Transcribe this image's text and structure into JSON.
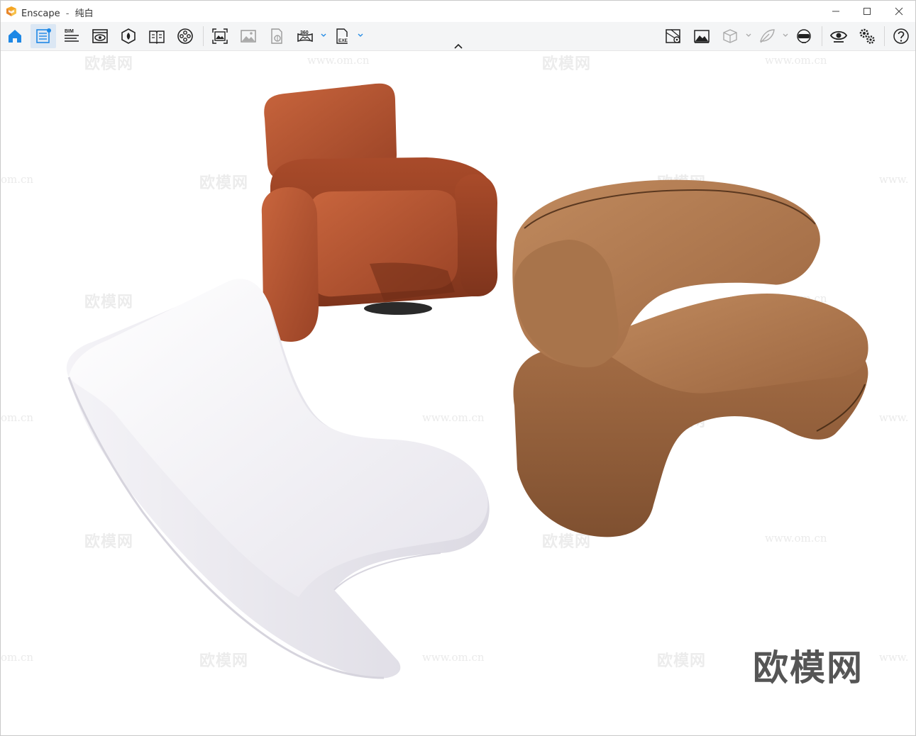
{
  "window": {
    "app_name": "Enscape",
    "separator": "-",
    "document_name": "纯白"
  },
  "toolbar": {
    "left": [
      {
        "name": "home-button",
        "icon": "home-icon",
        "active": false
      },
      {
        "name": "views-button",
        "icon": "view-list-icon",
        "active": true
      },
      {
        "name": "bim-button",
        "icon": "bim-icon",
        "label": "BIM",
        "active": false
      },
      {
        "name": "visual-settings-button",
        "icon": "eye-monitor-icon",
        "active": false
      },
      {
        "name": "asset-library-button",
        "icon": "asset-library-icon",
        "active": false
      },
      {
        "name": "material-editor-button",
        "icon": "book-icon",
        "active": false
      },
      {
        "name": "video-editor-button",
        "icon": "film-reel-icon",
        "active": false
      }
    ],
    "capture": [
      {
        "name": "screenshot-button",
        "icon": "screenshot-icon"
      },
      {
        "name": "batch-render-button",
        "icon": "image-gallery-icon"
      },
      {
        "name": "web-standalone-button",
        "icon": "file-export-icon"
      },
      {
        "name": "panorama-button",
        "icon": "panorama-icon",
        "label": "360",
        "dropdown": true
      },
      {
        "name": "exe-export-button",
        "icon": "exe-file-icon",
        "label": "EXE",
        "dropdown": true
      }
    ],
    "right": [
      {
        "name": "site-context-button",
        "icon": "map-pin-icon"
      },
      {
        "name": "atmosphere-button",
        "icon": "landscape-icon"
      },
      {
        "name": "object-mode-button",
        "icon": "cube-icon",
        "dropdown": true
      },
      {
        "name": "light-view-button",
        "icon": "feather-icon",
        "dropdown": true
      },
      {
        "name": "vr-headset-button",
        "icon": "vr-headset-icon"
      },
      {
        "name": "sync-view-button",
        "icon": "eye-icon"
      },
      {
        "name": "settings-button",
        "icon": "gears-icon"
      },
      {
        "name": "help-button",
        "icon": "help-icon"
      }
    ]
  },
  "watermarks": {
    "brand": "欧模网",
    "url": "www.om.cn",
    "url_partial_left": "om.cn",
    "url_partial_right": "www."
  },
  "colors": {
    "accent": "#1e88e5",
    "toolbar_bg": "#f4f5f6",
    "chair_terracotta": "#b4532f",
    "chair_tan": "#b0774f",
    "chair_white": "#f3f2f6"
  }
}
